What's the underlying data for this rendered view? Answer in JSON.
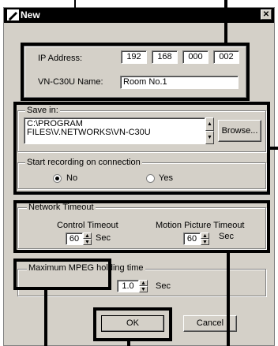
{
  "window": {
    "title": "New",
    "close_label": "✕"
  },
  "connection": {
    "ip_label": "IP Address:",
    "ip_octets": [
      "192",
      "168",
      "000",
      "002"
    ],
    "name_label": "VN-C30U Name:",
    "name_value": "Room No.1"
  },
  "save": {
    "group_label": "Save in:",
    "path_line1": "C:\\PROGRAM",
    "path_line2": "FILES\\V.NETWORKS\\VN-C30U",
    "browse_label": "Browse..."
  },
  "recording": {
    "group_label": "Start recording on connection",
    "options": [
      {
        "label": "No",
        "selected": true
      },
      {
        "label": "Yes",
        "selected": false
      }
    ]
  },
  "timeout": {
    "group_label": "Network Timeout",
    "control_label": "Control Timeout",
    "control_value": "60",
    "motion_label": "Motion Picture Timeout",
    "motion_value": "60",
    "unit": "Sec"
  },
  "mpeg": {
    "group_label": "Maximum MPEG holding time",
    "value": "1.0",
    "unit": "Sec"
  },
  "buttons": {
    "ok": "OK",
    "cancel": "Cancel"
  }
}
